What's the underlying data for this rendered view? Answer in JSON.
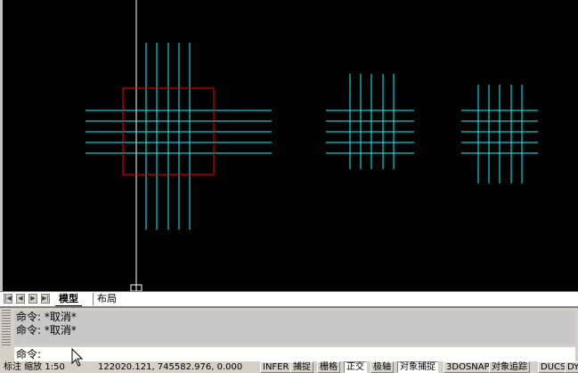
{
  "drawing": {
    "background": "#000000",
    "line_color": "#00ffff",
    "selection_color": "#ff0000",
    "crosshair_color": "#ffffff"
  },
  "tabs": {
    "nav_icons": [
      "first-tab-icon",
      "prev-tab-icon",
      "next-tab-icon",
      "last-tab-icon"
    ],
    "items": [
      {
        "label": "模型",
        "active": true
      },
      {
        "label": "布局",
        "active": false
      }
    ]
  },
  "command": {
    "history": [
      "命令: *取消*",
      "命令: *取消*"
    ],
    "prompt": "命令:"
  },
  "status": {
    "left_text": "标注 缩放 1:50",
    "coords": "122020.121, 745582.976, 0.000",
    "toggles": [
      {
        "label": "INFER",
        "on": false
      },
      {
        "label": "捕捉",
        "on": false
      },
      {
        "label": "栅格",
        "on": false
      },
      {
        "label": "正交",
        "on": true
      },
      {
        "label": "极轴",
        "on": false
      },
      {
        "label": "对象捕捉",
        "on": true
      },
      {
        "label": "3DOSNAP",
        "on": false
      },
      {
        "label": "对象追踪",
        "on": false
      },
      {
        "label": "DUCS",
        "on": false
      },
      {
        "label": "DY",
        "on": false
      }
    ]
  }
}
